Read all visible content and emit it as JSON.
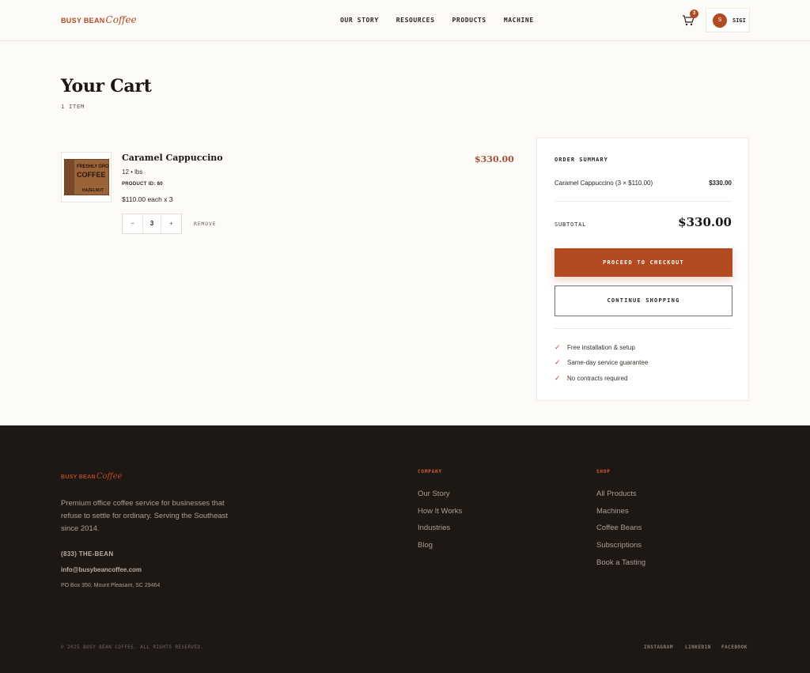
{
  "header": {
    "logo_main": "BUSY BEAN",
    "logo_script": "Coffee",
    "nav": [
      "OUR STORY",
      "RESOURCES",
      "PRODUCTS",
      "MACHINE"
    ],
    "cart_count": "3",
    "user_initial": "S",
    "user_name": "SIGI"
  },
  "cart": {
    "title": "Your Cart",
    "item_count": "1 ITEM",
    "items": [
      {
        "name": "Caramel Cappuccino",
        "size": "12 • lbs",
        "product_id": "PRODUCT ID: 80",
        "unit_line": "$110.00 each x 3",
        "total": "$330.00",
        "quantity": "3",
        "image_text": [
          "FRESHLY GRO",
          "COFFEE",
          "HAZELNUT"
        ]
      }
    ],
    "qty_minus": "−",
    "qty_plus": "+",
    "remove_label": "REMOVE"
  },
  "summary": {
    "title": "ORDER SUMMARY",
    "line_label": "Caramel Cappuccino (3 × $110.00)",
    "line_value": "$330.00",
    "subtotal_label": "SUBTOTAL",
    "subtotal_value": "$330.00",
    "checkout_label": "PROCEED TO CHECKOUT",
    "continue_label": "CONTINUE SHOPPING",
    "features": [
      "Free installation & setup",
      "Same-day service guarantee",
      "No contracts required"
    ]
  },
  "footer": {
    "logo_main": "BUSY BEAN",
    "logo_script": "Coffee",
    "description": "Premium office coffee service for businesses that refuse to settle for ordinary. Serving the Southeast since 2014.",
    "phone": "(833) THE-BEAN",
    "email": "info@busybeancoffee.com",
    "address": "PO Box 350, Mount Pleasant, SC 29464",
    "company_title": "COMPANY",
    "company_links": [
      "Our Story",
      "How It Works",
      "Industries",
      "Blog"
    ],
    "shop_title": "SHOP",
    "shop_links": [
      "All Products",
      "Machines",
      "Coffee Beans",
      "Subscriptions",
      "Book a Tasting"
    ],
    "copyright": "© 2025 BUSY BEAN COFFEE. ALL RIGHTS RESERVED.",
    "social": [
      "INSTAGRAM",
      "LINKEDIN",
      "FACEBOOK"
    ]
  },
  "colors": {
    "accent": "#b24a22",
    "footer_bg": "#1e1815",
    "page_bg": "#fdfbf8"
  }
}
